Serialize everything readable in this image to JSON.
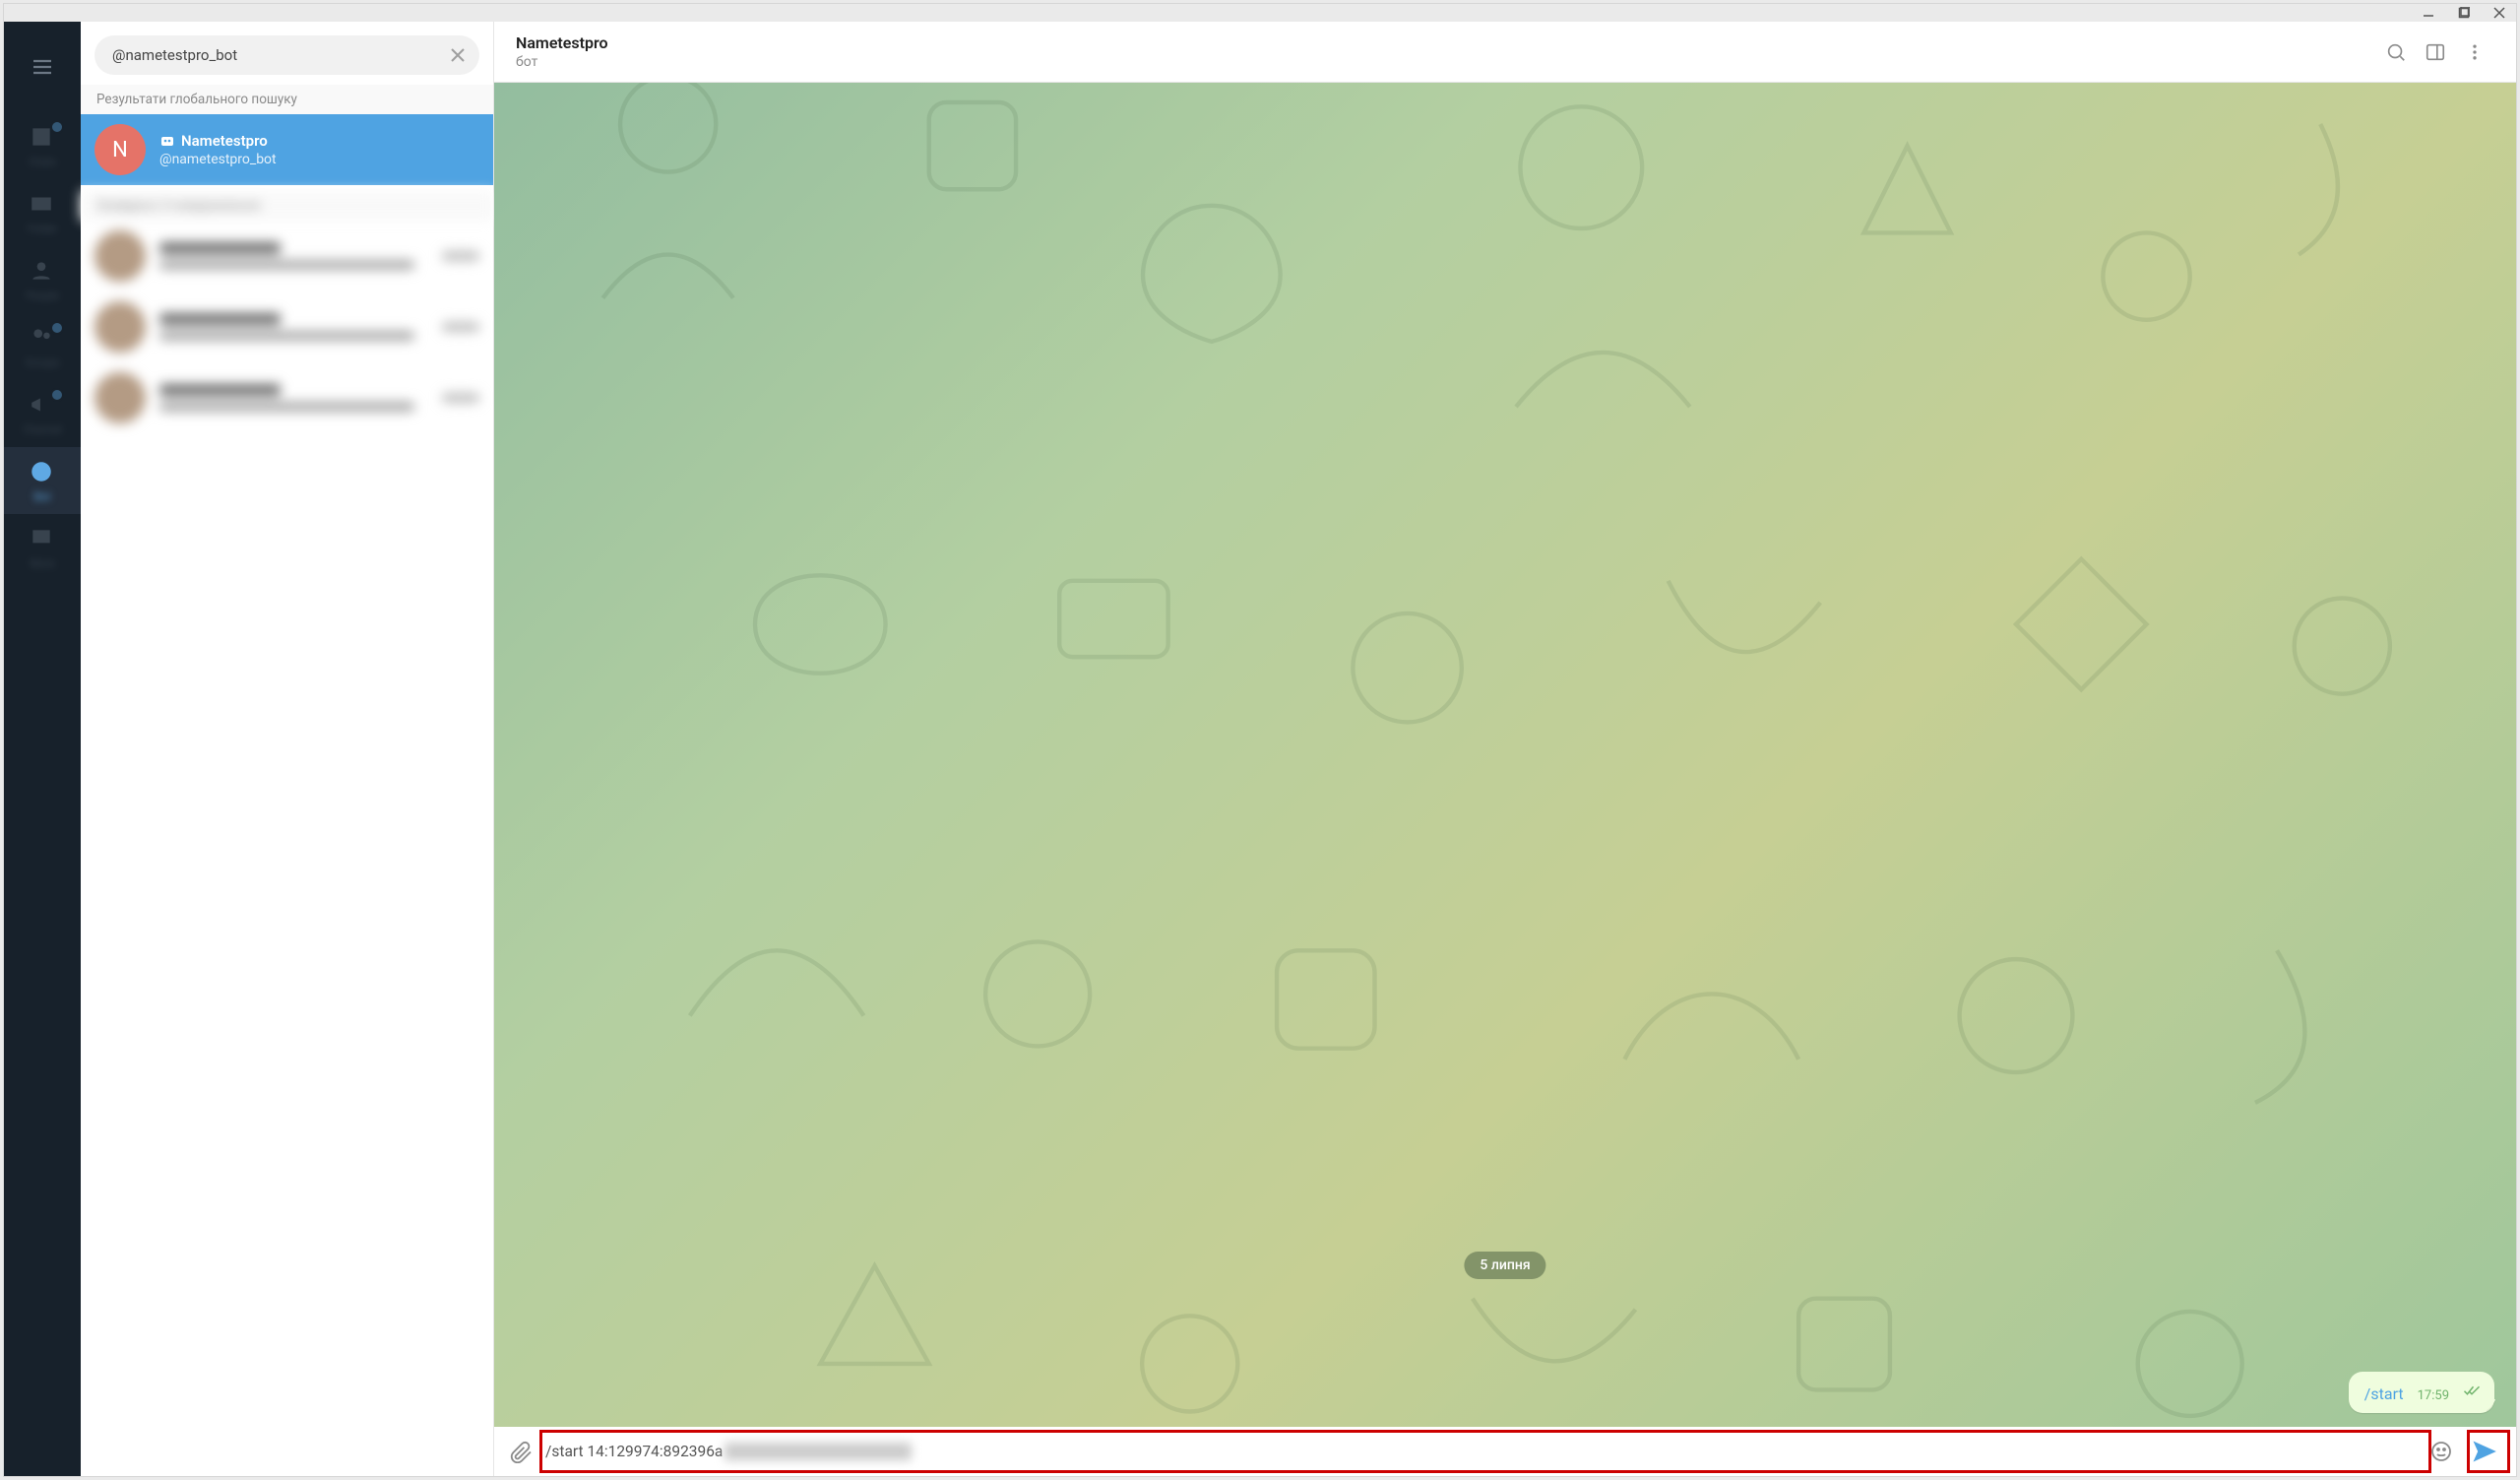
{
  "search": {
    "value": "@nametestpro_bot"
  },
  "section": {
    "global_results": "Результати глобального пошуку"
  },
  "selected_result": {
    "avatar_letter": "N",
    "title": "Nametestpro",
    "handle": "@nametestpro_bot"
  },
  "chat": {
    "title": "Nametestpro",
    "subtitle": "бот",
    "date_pill": "5 липня",
    "last_message": {
      "text": "/start",
      "time": "17:59"
    }
  },
  "composer": {
    "typed": "/start 14:129974:892396a"
  }
}
